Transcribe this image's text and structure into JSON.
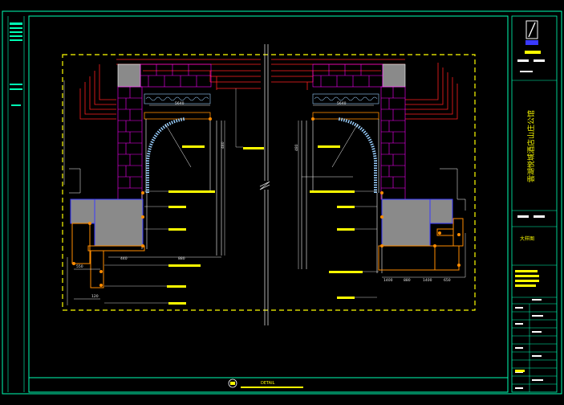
{
  "drawing": {
    "detail_label": "DETAIL",
    "project_name_vertical": "雲湖悦城酒店山庄公馆",
    "title_band_text": "大样图",
    "dimensions": {
      "left_upper": "5640",
      "left_mid": "480",
      "left_bottom_a": "440",
      "left_bottom_b": "880",
      "left_side_a": "550",
      "left_side_b": "120",
      "right_upper": "5640",
      "right_mid": "480",
      "right_bottom_a": "1400",
      "right_bottom_b": "880",
      "right_bottom_c": "1400",
      "right_bottom_d": "650"
    }
  },
  "colors": {
    "background": "#000000",
    "frame": "#00ffb4",
    "grid_wall": "#ff00ff",
    "red_steps": "#ff2020",
    "column": "#8a8a8a",
    "blue_outline": "#3a3aff",
    "yellow_text": "#ffff00",
    "dim_white": "#e8e8e8",
    "arch_cyan": "#9ad0ff"
  }
}
